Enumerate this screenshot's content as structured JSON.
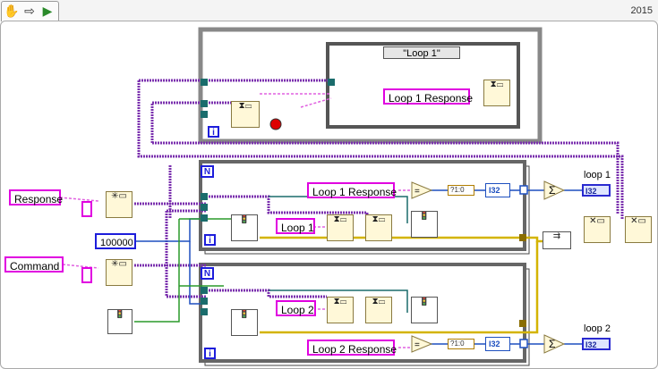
{
  "toolbar": {
    "version": "2015",
    "icons": [
      "hand-pointer-icon",
      "arrow-icon",
      "labview-run-icon"
    ]
  },
  "controls": {
    "response": "Response",
    "command": "Command",
    "timeout": "100000"
  },
  "case_structure": {
    "selector": "\"Loop 1\""
  },
  "constants": {
    "loop1_response_top": "Loop 1 Response",
    "loop1_response_mid": "Loop 1 Response",
    "loop1": "Loop 1",
    "loop2": "Loop 2",
    "loop2_response": "Loop 2 Response"
  },
  "indicators": {
    "loop1_label": "loop 1",
    "loop1_type": "I32",
    "loop2_label": "loop 2",
    "loop2_type": "I32"
  },
  "types": {
    "i32": "I32",
    "iter": "i",
    "count": "N"
  },
  "colors": {
    "string_wire": "#e060e0",
    "refnum_wire": "#7a2fae",
    "error_wire": "#d4b400",
    "int_wire": "#1d4fbf",
    "bool_wire": "#2a9a2a",
    "loop_border": "#999999"
  }
}
